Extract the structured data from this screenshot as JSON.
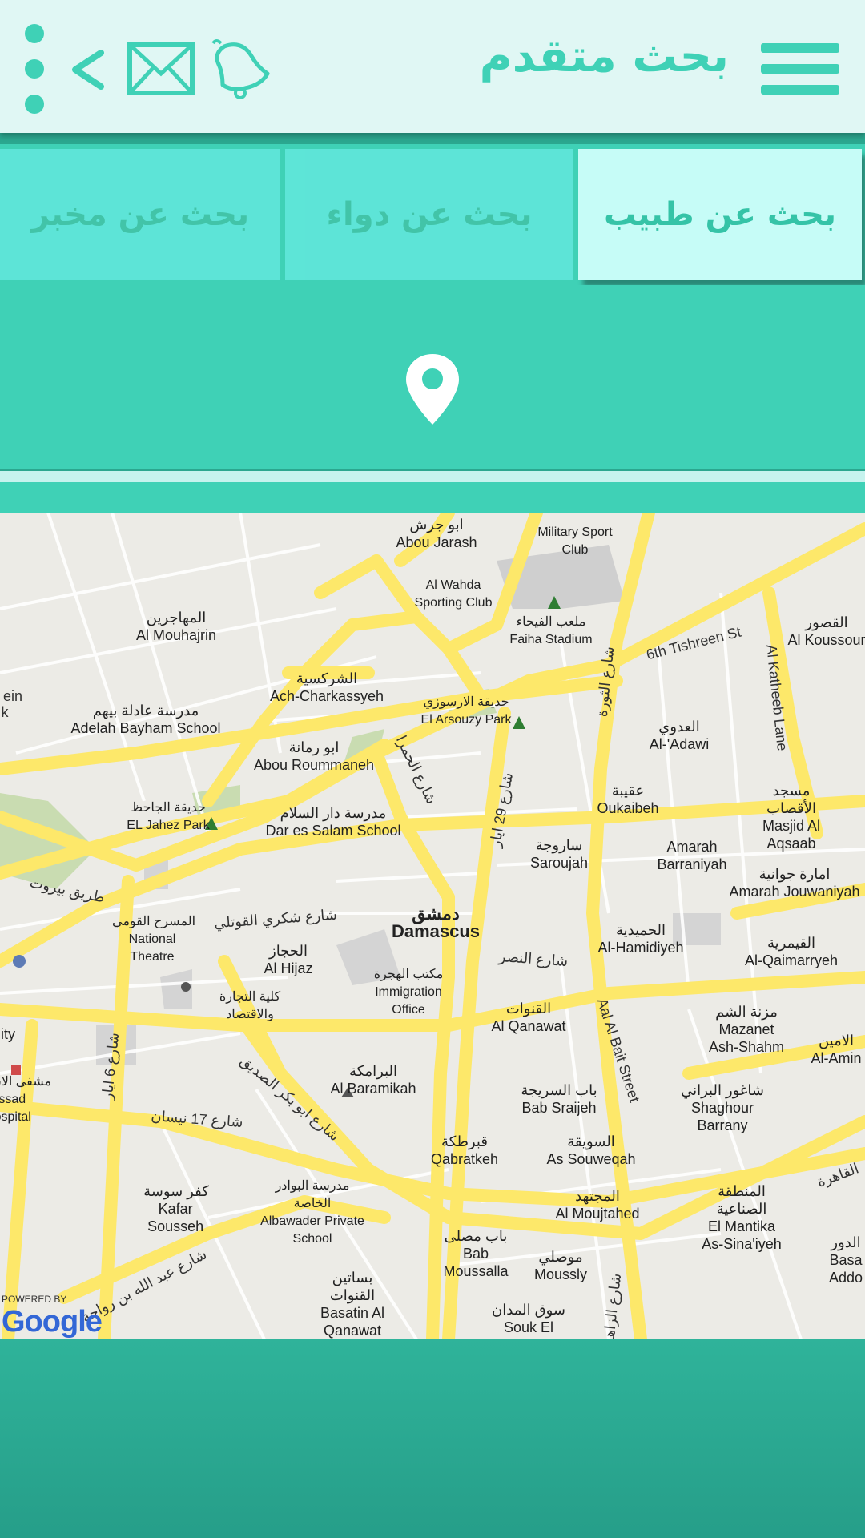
{
  "header": {
    "title": "بحث متقدم",
    "icons": [
      "menu-icon",
      "bell-icon",
      "mail-icon",
      "back-arrow-icon",
      "more-vertical-icon"
    ],
    "accent_color": "#3fd1b6",
    "background_color": "#e0f7f4"
  },
  "tabs": [
    {
      "label": "بحث عن طبيب",
      "active": true
    },
    {
      "label": "بحث عن دواء",
      "active": false
    },
    {
      "label": "بحث عن مخبر",
      "active": false
    }
  ],
  "location": {
    "icon": "location-pin-icon"
  },
  "map": {
    "attribution_small": "POWERED BY",
    "attribution_logo": "Google",
    "labels": [
      {
        "ar": "ابو جرش",
        "en": "Abou Jarash"
      },
      {
        "ar": "",
        "en": "Military Sport Club"
      },
      {
        "ar": "",
        "en": "Al Wahda Sporting Club"
      },
      {
        "ar": "ملعب الفيحاء",
        "en": "Faiha Stadium"
      },
      {
        "ar": "المهاجرين",
        "en": "Al Mouhajrin"
      },
      {
        "ar": "الشركسية",
        "en": "Ach-Charkassyeh"
      },
      {
        "ar": "حديقة الارسوزي",
        "en": "El Arsouzy Park"
      },
      {
        "ar": "مدرسة عادلة بيهم",
        "en": "Adelah Bayham School"
      },
      {
        "ar": "ابو رمانة",
        "en": "Abou Roummaneh"
      },
      {
        "ar": "العدوي",
        "en": "Al-'Adawi"
      },
      {
        "ar": "القصور",
        "en": "Al Koussour"
      },
      {
        "ar": "عقيبة",
        "en": "Oukaibeh"
      },
      {
        "ar": "مسجد الأقصاب",
        "en": "Masjid Al Aqsaab"
      },
      {
        "ar": "حديقة الجاحظ",
        "en": "EL Jahez Park"
      },
      {
        "ar": "مدرسة دار السلام",
        "en": "Dar es Salam School"
      },
      {
        "ar": "ساروجة",
        "en": "Saroujah"
      },
      {
        "ar": "",
        "en": "Amarah Barraniyah"
      },
      {
        "ar": "امارة جوانية",
        "en": "Amarah Jouwaniyah"
      },
      {
        "ar": "دمشق",
        "en": "Damascus"
      },
      {
        "ar": "المسرح القومي",
        "en": "National Theatre"
      },
      {
        "ar": "الحجاز",
        "en": "Al Hijaz"
      },
      {
        "ar": "الحميدية",
        "en": "Al-Hamidiyeh"
      },
      {
        "ar": "القيمرية",
        "en": "Al-Qaimarryeh"
      },
      {
        "ar": "مكتب الهجرة",
        "en": "Immigration Office"
      },
      {
        "ar": "كلية التجارة والاقتصاد",
        "en": ""
      },
      {
        "ar": "القنوات",
        "en": "Al Qanawat"
      },
      {
        "ar": "مزنة الشم",
        "en": "Mazanet Ash-Shahm"
      },
      {
        "ar": "الامين",
        "en": "Al-Amin"
      },
      {
        "ar": "البرامكة",
        "en": "Al Baramikah"
      },
      {
        "ar": "باب السريجة",
        "en": "Bab Sraijeh"
      },
      {
        "ar": "شاغور البراني",
        "en": "Shaghour Barrany"
      },
      {
        "ar": "قبرطكة",
        "en": "Qabratkeh"
      },
      {
        "ar": "السويقة",
        "en": "As Souweqah"
      },
      {
        "ar": "كفر سوسة",
        "en": "Kafar Sousseh"
      },
      {
        "ar": "مدرسة البوادر الخاصة",
        "en": "Albawader Private School"
      },
      {
        "ar": "المجتهد",
        "en": "Al Moujtahed"
      },
      {
        "ar": "المنطقة الصناعية",
        "en": "El Mantika As-Sina'iyeh"
      },
      {
        "ar": "باب مصلى",
        "en": "Bab Moussalla"
      },
      {
        "ar": "موصلي",
        "en": "Moussly"
      },
      {
        "ar": "بساتين القنوات",
        "en": "Basatin Al Qanawat"
      },
      {
        "ar": "سوق المدان",
        "en": "Souk El"
      },
      {
        "ar": "مشفى الاسد",
        "en": "Assad Hospital"
      },
      {
        "ar": "",
        "en": "ity"
      },
      {
        "ar": "الدور",
        "en": "Basa Addo"
      }
    ],
    "roads": [
      {
        "label": "6th Tishreen St"
      },
      {
        "label": "Al Katheeb Lane"
      },
      {
        "label": "شارع الثورة"
      },
      {
        "label": "شارع 29 ايار"
      },
      {
        "label": "شارع الحمرا"
      },
      {
        "label": "طريق بيروت"
      },
      {
        "label": "شارع شكري القوتلي"
      },
      {
        "label": "شارع النصر"
      },
      {
        "label": "Aal Al Bait Street"
      },
      {
        "label": "شارع 6 ايار"
      },
      {
        "label": "شارع 17 نيسان"
      },
      {
        "label": "شارع ابو بكر الصديق"
      },
      {
        "label": "شارع عبد الله بن رواحة"
      },
      {
        "label": "شارع الزاهرة"
      },
      {
        "label": "القاهرة"
      },
      {
        "label": "ein"
      },
      {
        "label": "k"
      }
    ]
  }
}
